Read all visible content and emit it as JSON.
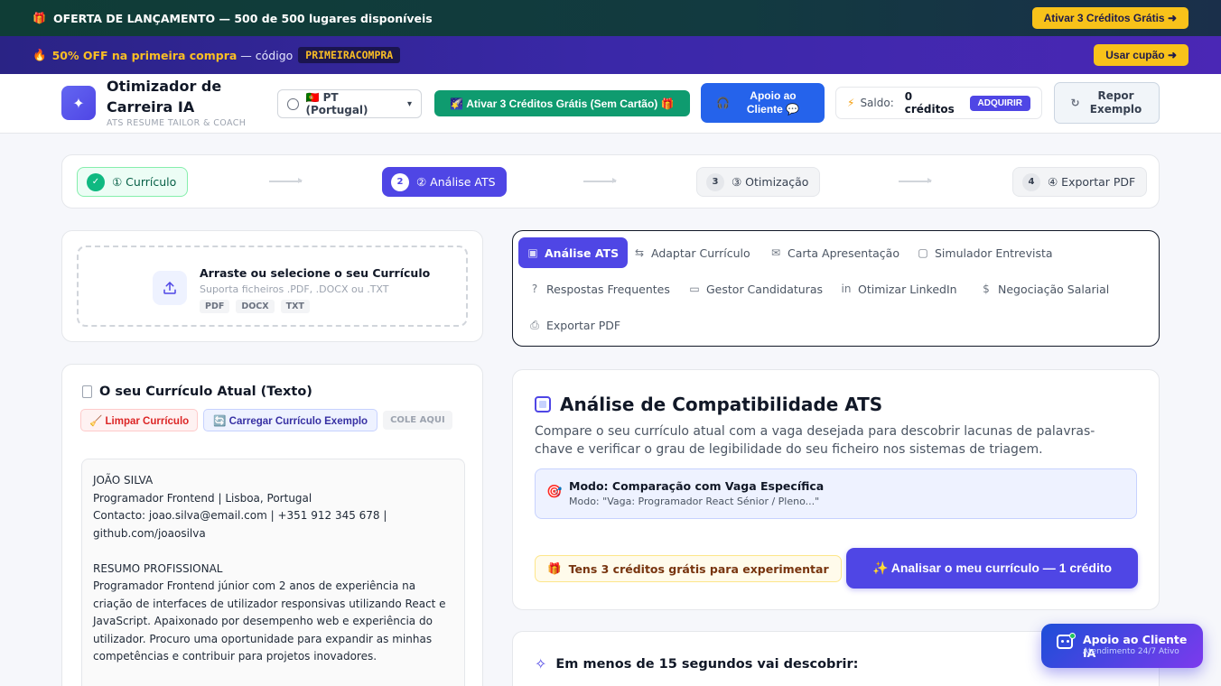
{
  "banners": {
    "launch": {
      "icon": "gift-icon",
      "text": "OFERTA DE LANÇAMENTO — 500 de 500 lugares disponíveis",
      "cta": "Ativar 3 Créditos Grátis ➜"
    },
    "coupon": {
      "icon": "fire-icon",
      "highlight": "50% OFF na primeira compra",
      "text": "— código",
      "code": "PRIMEIRACOMPRA",
      "cta": "Usar cupão ➜"
    }
  },
  "header": {
    "logo_icon": "sparkle-icon",
    "title": "Otimizador de Carreira IA",
    "subtitle": "ATS RESUME TAILOR & COACH",
    "language": "🇵🇹 PT (Portugal)",
    "free_credits": "🌠 Ativar 3 Créditos Grátis (Sem Cartão) 🎁",
    "support": "Apoio ao Cliente 💬",
    "balance_label": "Saldo:",
    "balance_value": "0 créditos",
    "buy": "ADQUIRIR",
    "reset": "Repor Exemplo"
  },
  "steps": [
    {
      "num": "✓",
      "label": "① Currículo",
      "state": "done"
    },
    {
      "num": "2",
      "label": "② Análise ATS",
      "state": "active"
    },
    {
      "num": "3",
      "label": "③ Otimização",
      "state": "todo"
    },
    {
      "num": "4",
      "label": "④ Exportar PDF",
      "state": "todo"
    }
  ],
  "upload": {
    "title": "Arraste ou selecione o seu Currículo",
    "subtitle": "Suporta ficheiros .PDF, .DOCX ou .TXT",
    "tags": [
      "PDF",
      "DOCX",
      "TXT"
    ]
  },
  "resume": {
    "title": "O seu Currículo Atual (Texto)",
    "clear": "🧹 Limpar Currículo",
    "load_example": "🔄 Carregar Currículo Exemplo",
    "paste_hint": "COLE AQUI",
    "text": "JOÃO SILVA\nProgramador Frontend | Lisboa, Portugal\nContacto: joao.silva@email.com | +351 912 345 678 |\ngithub.com/joaosilva\n\nRESUMO PROFISSIONAL\nProgramador Frontend júnior com 2 anos de experiência na criação de interfaces de utilizador responsivas utilizando React e JavaScript. Apaixonado por desempenho web e experiência do utilizador. Procuro uma oportunidade para expandir as minhas competências e contribuir para projetos inovadores.\n\nHABILIDADES"
  },
  "tabs": [
    {
      "label": "Análise ATS",
      "icon": "chip-icon",
      "active": true
    },
    {
      "label": "Adaptar Currículo",
      "icon": "swap-icon",
      "active": false
    },
    {
      "label": "Carta Apresentação",
      "icon": "mail-icon",
      "active": false
    },
    {
      "label": "Simulador Entrevista",
      "icon": "chat-icon",
      "active": false
    },
    {
      "label": "Respostas Frequentes",
      "icon": "help-icon",
      "active": false
    },
    {
      "label": "Gestor Candidaturas",
      "icon": "folder-icon",
      "active": false
    },
    {
      "label": "Otimizar LinkedIn",
      "icon": "linkedin-icon",
      "active": false
    },
    {
      "label": "Negociação Salarial",
      "icon": "dollar-icon",
      "active": false
    },
    {
      "label": "Exportar PDF",
      "icon": "printer-icon",
      "active": false
    }
  ],
  "ats": {
    "title": "Análise de Compatibilidade ATS",
    "description": "Compare o seu currículo atual com a vaga desejada para descobrir lacunas de palavras-chave e verificar o grau de legibilidade do seu ficheiro nos sistemas de triagem.",
    "mode_title": "Modo: Comparação com Vaga Específica",
    "mode_sub": "Modo: \"Vaga: Programador React Sénior / Pleno...\"",
    "free_note": "Tens 3 créditos grátis para experimentar",
    "analyze": "✨ Analisar o meu currículo — 1 crédito"
  },
  "results": {
    "title": "Em menos de 15 segundos vai descobrir:"
  },
  "assistant": {
    "title": "Apoio ao Cliente IA",
    "subtitle": "Atendimento 24/7 Ativo"
  },
  "colors": {
    "primary": "#4f46e5",
    "success": "#10b981",
    "accent": "#f8c21a",
    "support": "#2563eb"
  }
}
